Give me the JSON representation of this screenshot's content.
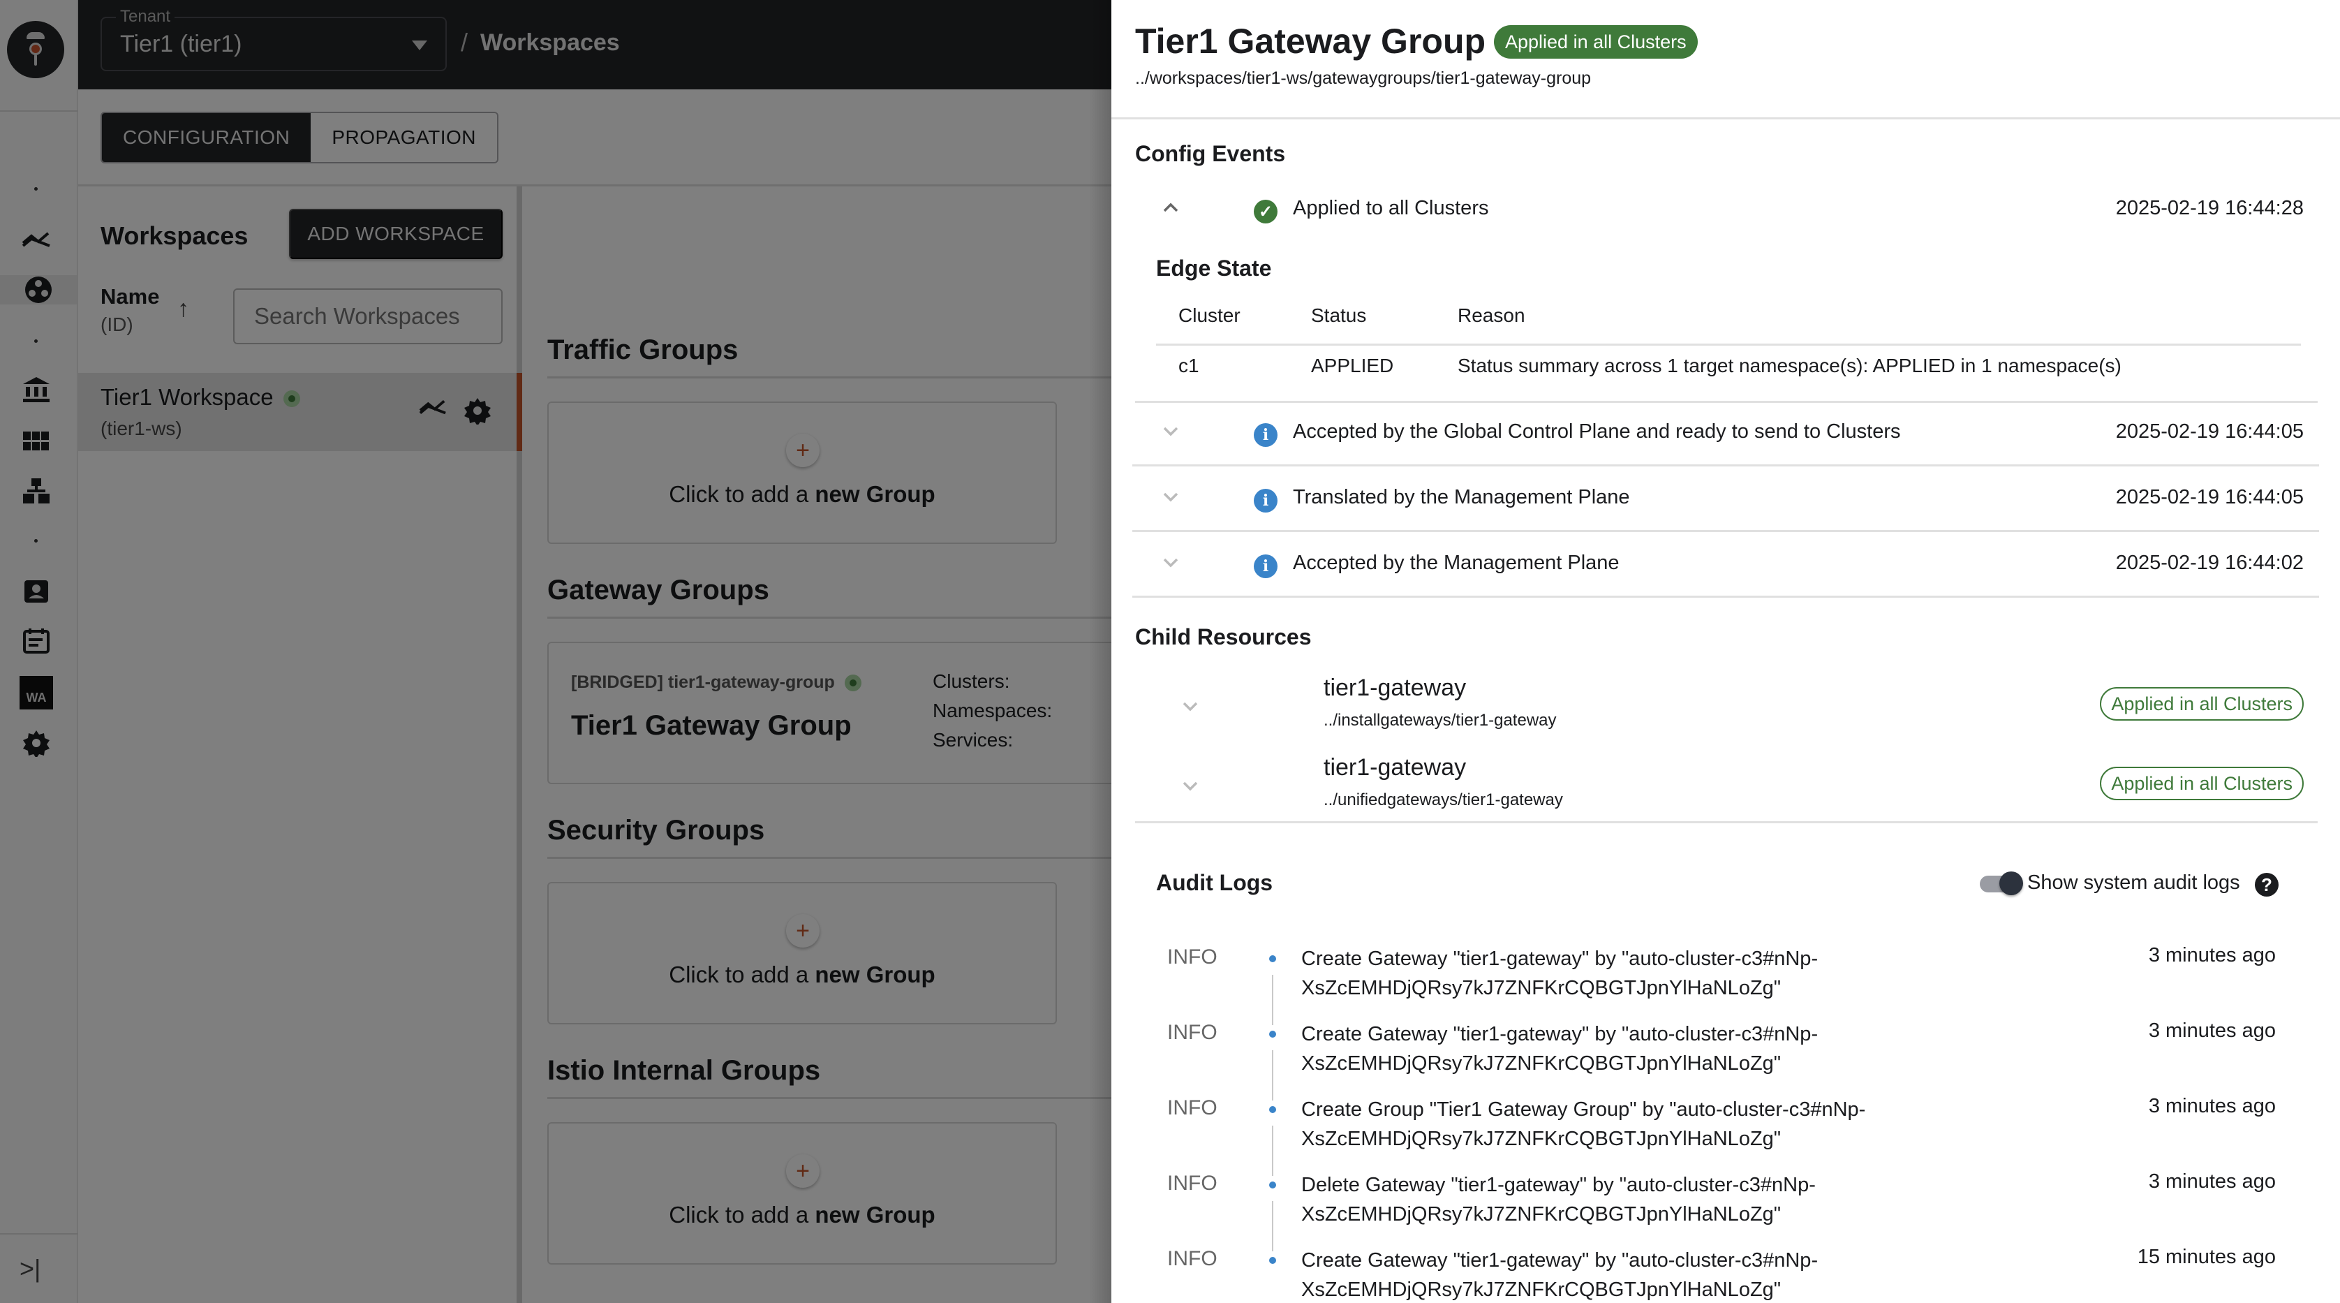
{
  "topbar": {
    "tenant_label": "Tenant",
    "tenant_value": "Tier1 (tier1)",
    "breadcrumb_sep": "/",
    "breadcrumb": "Workspaces"
  },
  "tabs": [
    {
      "label": "CONFIGURATION",
      "active": true
    },
    {
      "label": "PROPAGATION",
      "active": false
    }
  ],
  "rail": {
    "items": [
      "metrics-icon",
      "workspaces-icon",
      "bank-icon",
      "grid-icon",
      "hierarchy-icon",
      "badge-icon",
      "events-icon",
      "wa-icon",
      "settings-icon"
    ],
    "wa_label": "WA",
    "collapse": ">|"
  },
  "workspaces": {
    "title": "Workspaces",
    "add_button": "ADD WORKSPACE",
    "sort_name": "Name",
    "sort_id": "(ID)",
    "search_placeholder": "Search Workspaces",
    "items": [
      {
        "name": "Tier1 Workspace",
        "id": "(tier1-ws)",
        "status": "healthy"
      }
    ]
  },
  "groups": {
    "add_prefix": "Click to add a ",
    "add_bold": "new Group",
    "plus": "+",
    "sections": [
      {
        "title": "Traffic Groups"
      },
      {
        "title": "Gateway Groups"
      },
      {
        "title": "Security Groups"
      },
      {
        "title": "Istio Internal Groups"
      }
    ],
    "gateway_card": {
      "subtitle": "[BRIDGED] tier1-gateway-group",
      "title": "Tier1 Gateway Group",
      "clusters_label": "Clusters:",
      "namespaces_label": "Namespaces:",
      "services_label": "Services:"
    }
  },
  "drawer": {
    "title": "Tier1 Gateway Group",
    "status_badge": "Applied in all Clusters",
    "path": "../workspaces/tier1-ws/gatewaygroups/tier1-gateway-group",
    "config_events_title": "Config Events",
    "events": [
      {
        "text": "Applied to all Clusters",
        "time": "2025-02-19 16:44:28",
        "type": "success",
        "expanded": true
      },
      {
        "text": "Accepted by the Global Control Plane and ready to send to Clusters",
        "time": "2025-02-19 16:44:05",
        "type": "info",
        "expanded": false
      },
      {
        "text": "Translated by the Management Plane",
        "time": "2025-02-19 16:44:05",
        "type": "info",
        "expanded": false
      },
      {
        "text": "Accepted by the Management Plane",
        "time": "2025-02-19 16:44:02",
        "type": "info",
        "expanded": false
      }
    ],
    "edge_state": {
      "title": "Edge State",
      "columns": [
        "Cluster",
        "Status",
        "Reason"
      ],
      "rows": [
        [
          "c1",
          "APPLIED",
          "Status summary across 1 target namespace(s): APPLIED in 1 namespace(s)"
        ]
      ]
    },
    "child_resources_title": "Child Resources",
    "children": [
      {
        "name": "tier1-gateway",
        "path": "../installgateways/tier1-gateway",
        "status": "Applied in all Clusters"
      },
      {
        "name": "tier1-gateway",
        "path": "../unifiedgateways/tier1-gateway",
        "status": "Applied in all Clusters"
      }
    ],
    "audit": {
      "title": "Audit Logs",
      "toggle_label": "Show system audit logs",
      "toggle_on": true,
      "help": "?",
      "logs": [
        {
          "level": "INFO",
          "text1": "Create Gateway \"tier1-gateway\" by \"auto-cluster-c3#nNp-",
          "text2": "XsZcEMHDjQRsy7kJ7ZNFKrCQBGTJpnYlHaNLoZg\"",
          "time": "3 minutes ago"
        },
        {
          "level": "INFO",
          "text1": "Create Gateway \"tier1-gateway\" by \"auto-cluster-c3#nNp-",
          "text2": "XsZcEMHDjQRsy7kJ7ZNFKrCQBGTJpnYlHaNLoZg\"",
          "time": "3 minutes ago"
        },
        {
          "level": "INFO",
          "text1": "Create Group \"Tier1 Gateway Group\" by \"auto-cluster-c3#nNp-",
          "text2": "XsZcEMHDjQRsy7kJ7ZNFKrCQBGTJpnYlHaNLoZg\"",
          "time": "3 minutes ago"
        },
        {
          "level": "INFO",
          "text1": "Delete Gateway \"tier1-gateway\" by \"auto-cluster-c3#nNp-",
          "text2": "XsZcEMHDjQRsy7kJ7ZNFKrCQBGTJpnYlHaNLoZg\"",
          "time": "3 minutes ago"
        },
        {
          "level": "INFO",
          "text1": "Create Gateway \"tier1-gateway\" by \"auto-cluster-c3#nNp-",
          "text2": "XsZcEMHDjQRsy7kJ7ZNFKrCQBGTJpnYlHaNLoZg\"",
          "time": "15 minutes ago"
        }
      ]
    }
  },
  "colors": {
    "success": "#3f7a3a",
    "info": "#3a84c9",
    "accent": "#c3542a",
    "dark": "#232427"
  }
}
